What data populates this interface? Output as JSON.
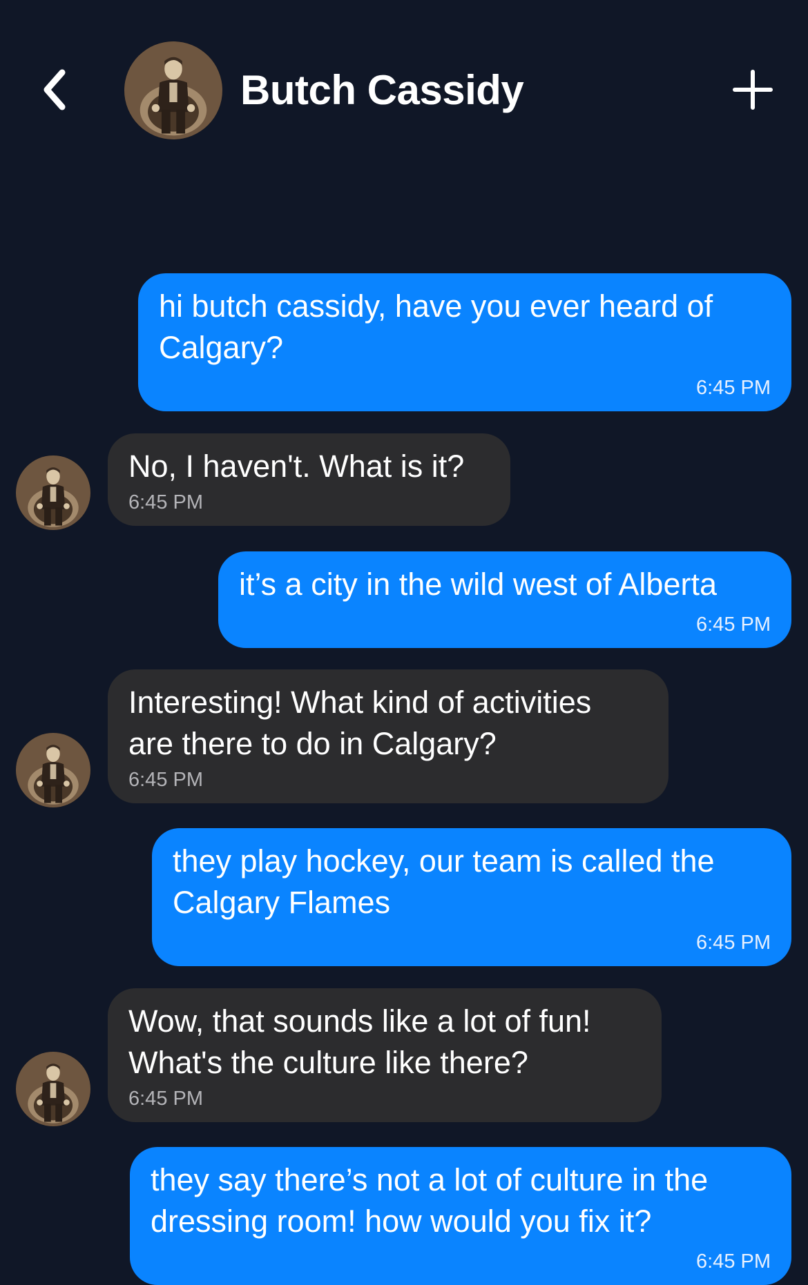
{
  "header": {
    "contact_name": "Butch Cassidy",
    "back_icon": "chevron-left-icon",
    "add_icon": "plus-icon"
  },
  "colors": {
    "background": "#101727",
    "user_bubble": "#0a84ff",
    "bot_bubble": "#2c2c2e"
  },
  "messages": [
    {
      "sender": "user",
      "text": "hi butch cassidy, have you ever heard of\nCalgary?",
      "time": "6:45 PM"
    },
    {
      "sender": "bot",
      "text": "No, I haven't. What is it?",
      "time": "6:45 PM"
    },
    {
      "sender": "user",
      "text": "it’s a city in the wild west of Alberta",
      "time": "6:45 PM"
    },
    {
      "sender": "bot",
      "text": "Interesting! What kind of activities\nare there to do in Calgary?",
      "time": "6:45 PM"
    },
    {
      "sender": "user",
      "text": "they play hockey, our team is called the\nCalgary Flames",
      "time": "6:45 PM"
    },
    {
      "sender": "bot",
      "text": "Wow, that sounds like a lot of fun!\nWhat's the culture like there?",
      "time": "6:45 PM"
    },
    {
      "sender": "user",
      "text": "they say there’s not a lot of culture in the\ndressing room! how would you fix it?",
      "time": "6:45 PM"
    }
  ]
}
